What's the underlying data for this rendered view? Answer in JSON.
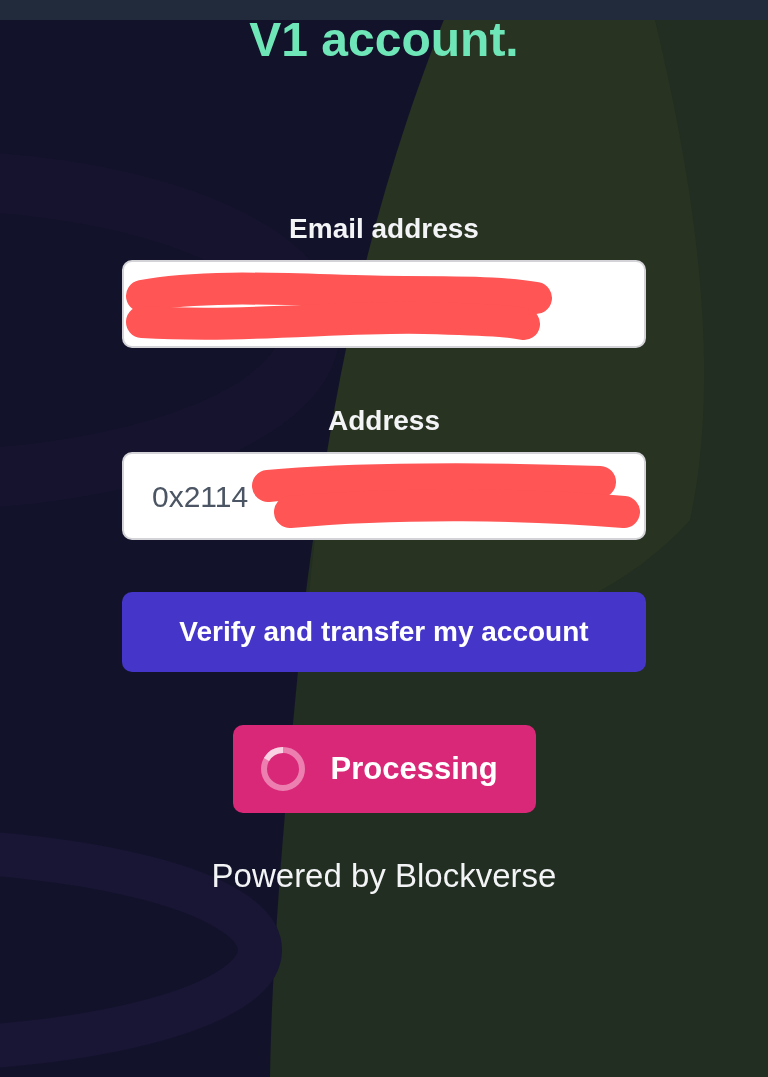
{
  "heading": "V1 account.",
  "form": {
    "fields": [
      {
        "label": "Email address",
        "redacted": true
      },
      {
        "label": "Address",
        "value": "0x2114",
        "redacted": true
      }
    ]
  },
  "buttons": [
    {
      "label": "Verify and transfer my account",
      "kind": "primary"
    },
    {
      "label": "Processing",
      "kind": "loading"
    }
  ],
  "footer": "Powered by Blockverse"
}
